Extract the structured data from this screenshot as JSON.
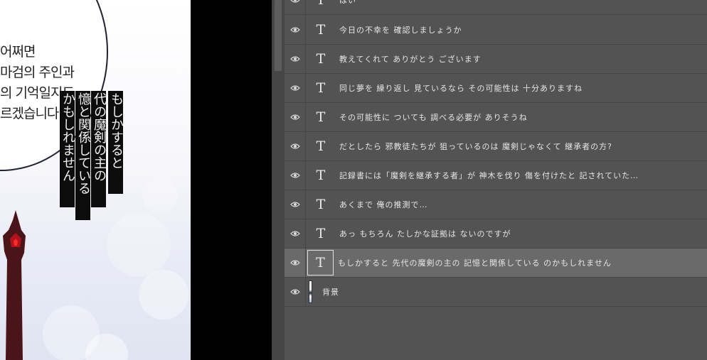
{
  "canvas": {
    "speech_bubble_lines": [
      "어쩌면",
      "마검의 주인과",
      "의 기억일지도",
      "르겠습니다."
    ],
    "vertical_text_columns": [
      "もしかすると",
      "代の魔剣の主の",
      "憶と関係している",
      "かもしれません"
    ]
  },
  "layers_panel": {
    "layers": [
      {
        "type": "text",
        "thumb_glyph": "T",
        "name": "はい",
        "visible": true,
        "selected": false
      },
      {
        "type": "text",
        "thumb_glyph": "T",
        "name": "今日の不幸を 確認しましょうか",
        "visible": true,
        "selected": false
      },
      {
        "type": "text",
        "thumb_glyph": "T",
        "name": "教えてくれて ありがとう ございます",
        "visible": true,
        "selected": false
      },
      {
        "type": "text",
        "thumb_glyph": "T",
        "name": "同じ夢を 繰り返し 見ているなら その可能性は 十分ありますね",
        "visible": true,
        "selected": false
      },
      {
        "type": "text",
        "thumb_glyph": "T",
        "name": "その可能性に ついても 調べる必要が ありそうね",
        "visible": true,
        "selected": false
      },
      {
        "type": "text",
        "thumb_glyph": "T",
        "name": "だとしたら 邪教徒たちが 狙っているのは 魔剣じゃなくて 継承者の方?",
        "visible": true,
        "selected": false
      },
      {
        "type": "text",
        "thumb_glyph": "T",
        "name": "記録書には「魔剣を継承する者」が 神木を伐り 傷を付けたと 記されていた…",
        "visible": true,
        "selected": false
      },
      {
        "type": "text",
        "thumb_glyph": "T",
        "name": "あくまで 俺の推測で…",
        "visible": true,
        "selected": false
      },
      {
        "type": "text",
        "thumb_glyph": "T",
        "name": "あっ もちろん たしかな証拠は ないのですが",
        "visible": true,
        "selected": false
      },
      {
        "type": "text",
        "thumb_glyph": "T",
        "name": "もしかすると 先代の魔剣の主の 記憶と関係している のかもしれません",
        "visible": true,
        "selected": true
      },
      {
        "type": "image",
        "thumb_glyph": "",
        "name": "背景",
        "visible": true,
        "selected": false
      }
    ]
  },
  "icons": {
    "visibility": "eye-icon",
    "text_layer": "T"
  },
  "colors": {
    "panel_bg": "#535353",
    "selected_row_bg": "#6a6a6a",
    "divider": "#454545",
    "layer_text": "#e6e6e6",
    "canvas_gap": "#000000"
  }
}
